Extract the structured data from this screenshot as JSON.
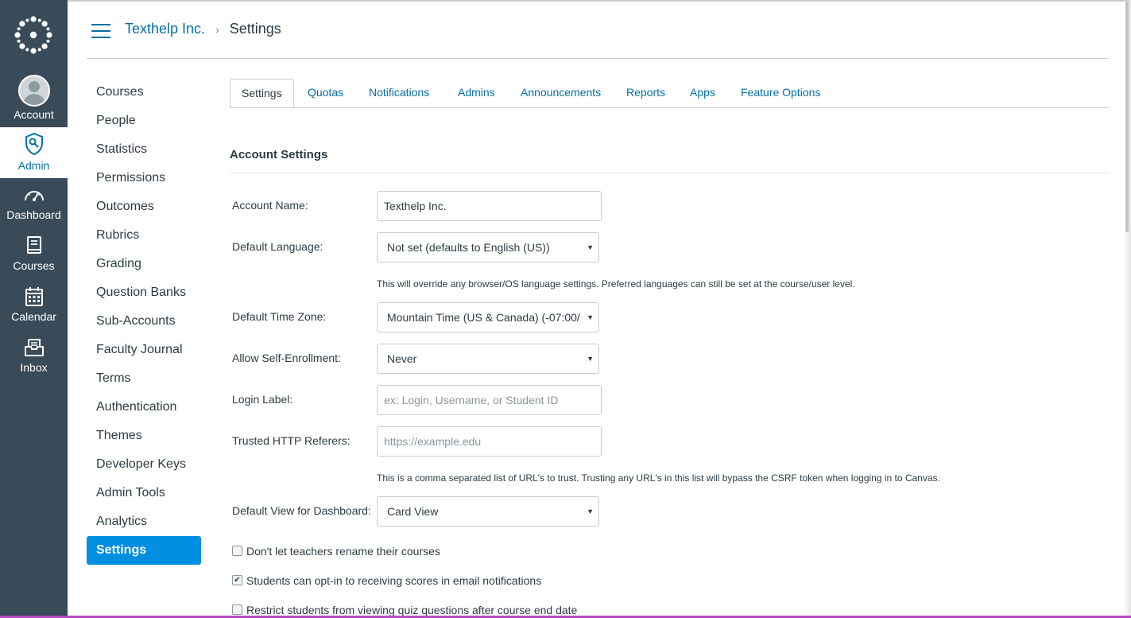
{
  "global_nav": {
    "items": [
      {
        "label": "Account",
        "icon": "account-avatar"
      },
      {
        "label": "Admin",
        "icon": "admin-shield-icon"
      },
      {
        "label": "Dashboard",
        "icon": "dashboard-gauge-icon"
      },
      {
        "label": "Courses",
        "icon": "courses-book-icon"
      },
      {
        "label": "Calendar",
        "icon": "calendar-icon"
      },
      {
        "label": "Inbox",
        "icon": "inbox-icon"
      }
    ],
    "active": "Admin",
    "background": "#394b58"
  },
  "header": {
    "breadcrumb_link": "Texthelp Inc.",
    "breadcrumb_separator": "›",
    "breadcrumb_current": "Settings"
  },
  "subnav": {
    "items": [
      "Courses",
      "People",
      "Statistics",
      "Permissions",
      "Outcomes",
      "Rubrics",
      "Grading",
      "Question Banks",
      "Sub-Accounts",
      "Faculty Journal",
      "Terms",
      "Authentication",
      "Themes",
      "Developer Keys",
      "Admin Tools",
      "Analytics",
      "Settings"
    ],
    "active": "Settings",
    "active_color": "#008ee2"
  },
  "tabs": [
    "Settings",
    "Quotas",
    "Notifications",
    "Admins",
    "Announcements",
    "Reports",
    "Apps",
    "Feature Options"
  ],
  "active_tab": "Settings",
  "section_title": "Account Settings",
  "form": {
    "account_name": {
      "label": "Account Name:",
      "value": "Texthelp Inc."
    },
    "default_language": {
      "label": "Default Language:",
      "value": "Not set (defaults to English (US))",
      "hint": "This will override any browser/OS language settings. Preferred languages can still be set at the course/user level."
    },
    "time_zone": {
      "label": "Default Time Zone:",
      "value": "Mountain Time (US & Canada) (-07:00/"
    },
    "self_enrollment": {
      "label": "Allow Self-Enrollment:",
      "value": "Never"
    },
    "login_label": {
      "label": "Login Label:",
      "placeholder": "ex: Login, Username, or Student ID"
    },
    "trusted_referers": {
      "label": "Trusted HTTP Referers:",
      "placeholder": "https://example.edu",
      "hint": "This is a comma separated list of URL's to trust. Trusting any URL's in this list will bypass the CSRF token when logging in to Canvas."
    },
    "dashboard_view": {
      "label": "Default View for Dashboard:",
      "value": "Card View"
    },
    "checkboxes": [
      {
        "label": "Don't let teachers rename their courses",
        "checked": false
      },
      {
        "label": "Students can opt-in to receiving scores in email notifications",
        "checked": true
      },
      {
        "label": "Restrict students from viewing quiz questions after course end date",
        "checked": false
      }
    ]
  },
  "colors": {
    "link": "#0770a3",
    "text": "#2d3b45",
    "border": "#c7cdd1"
  }
}
